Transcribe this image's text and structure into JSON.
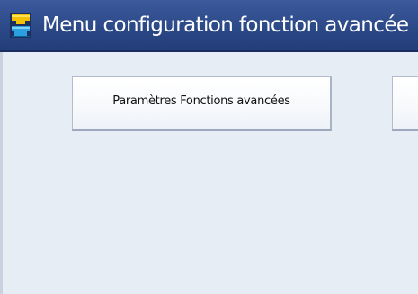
{
  "title": {
    "text": "Menu configuration fonction avancée",
    "icon": "tools-icon"
  },
  "buttons": [
    {
      "label": "Paramètres Fonctions avancées"
    },
    {
      "label": ""
    }
  ],
  "colors": {
    "title_bar": "#2c4988",
    "title_text": "#ffffff",
    "content_background": "#e6edf5",
    "button_background": "#f7f9fc",
    "button_border": "#b3bccb",
    "icon_yellow": "#f2c200",
    "icon_blue": "#2aa0e0"
  }
}
